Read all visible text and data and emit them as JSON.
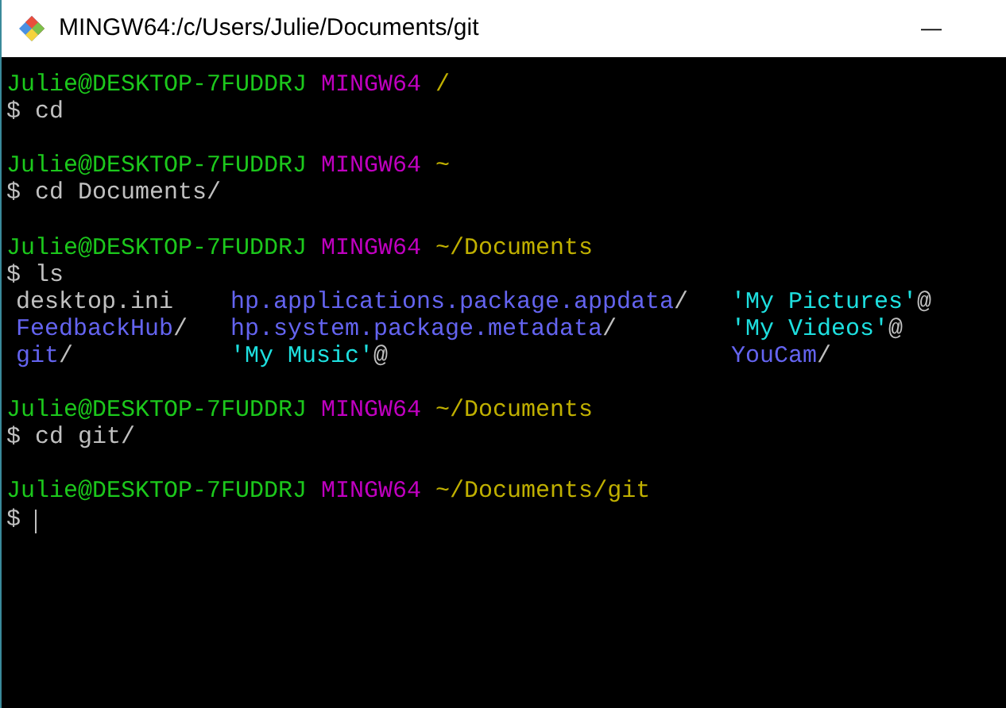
{
  "window": {
    "title": "MINGW64:/c/Users/Julie/Documents/git",
    "minimize": "—"
  },
  "sessions": [
    {
      "prompt": {
        "user_host": "Julie@DESKTOP-7FUDDRJ",
        "system": "MINGW64",
        "path": "/"
      },
      "command": "cd"
    },
    {
      "prompt": {
        "user_host": "Julie@DESKTOP-7FUDDRJ",
        "system": "MINGW64",
        "path": "~"
      },
      "command": "cd Documents/"
    },
    {
      "prompt": {
        "user_host": "Julie@DESKTOP-7FUDDRJ",
        "system": "MINGW64",
        "path": "~/Documents"
      },
      "command": "ls",
      "listing": [
        [
          {
            "name": "desktop.ini",
            "kind": "file"
          },
          {
            "name": "hp.applications.package.appdata",
            "suffix": "/",
            "kind": "dir"
          },
          {
            "name": "'My Pictures'",
            "suffix": "@",
            "kind": "link"
          }
        ],
        [
          {
            "name": "FeedbackHub",
            "suffix": "/",
            "kind": "dir"
          },
          {
            "name": "hp.system.package.metadata",
            "suffix": "/",
            "kind": "dir"
          },
          {
            "name": "'My Videos'",
            "suffix": "@",
            "kind": "link"
          }
        ],
        [
          {
            "name": "git",
            "suffix": "/",
            "kind": "dir"
          },
          {
            "name": "'My Music'",
            "suffix": "@",
            "kind": "link"
          },
          {
            "name": "YouCam",
            "suffix": "/",
            "kind": "dir"
          }
        ]
      ]
    },
    {
      "prompt": {
        "user_host": "Julie@DESKTOP-7FUDDRJ",
        "system": "MINGW64",
        "path": "~/Documents"
      },
      "command": "cd git/"
    },
    {
      "prompt": {
        "user_host": "Julie@DESKTOP-7FUDDRJ",
        "system": "MINGW64",
        "path": "~/Documents/git"
      },
      "cursor": true
    }
  ],
  "prompt_symbol": "$"
}
